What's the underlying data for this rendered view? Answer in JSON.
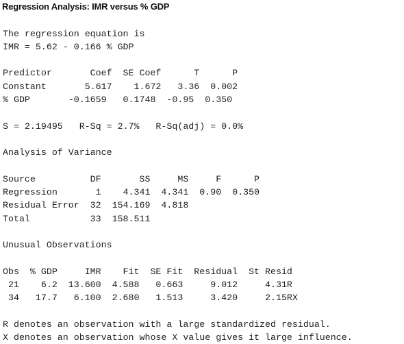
{
  "title": "Regression Analysis: IMR versus % GDP",
  "equation": {
    "intro": "The regression equation is",
    "formula": "IMR = 5.62 - 0.166 % GDP"
  },
  "coefficients": {
    "header": "Predictor       Coef  SE Coef      T      P",
    "rows": [
      "Constant       5.617    1.672   3.36  0.002",
      "% GDP       -0.1659   0.1748  -0.95  0.350"
    ],
    "data": [
      {
        "predictor": "Constant",
        "coef": "5.617",
        "se_coef": "1.672",
        "t": "3.36",
        "p": "0.002"
      },
      {
        "predictor": "% GDP",
        "coef": "-0.1659",
        "se_coef": "0.1748",
        "t": "-0.95",
        "p": "0.350"
      }
    ]
  },
  "fit_stats": {
    "line": "S = 2.19495   R-Sq = 2.7%   R-Sq(adj) = 0.0%",
    "s": "2.19495",
    "r_sq": "2.7%",
    "r_sq_adj": "0.0%"
  },
  "anova": {
    "heading": "Analysis of Variance",
    "header": "Source          DF       SS     MS     F      P",
    "rows": [
      "Regression       1    4.341  4.341  0.90  0.350",
      "Residual Error  32  154.169  4.818",
      "Total           33  158.511"
    ],
    "data": [
      {
        "source": "Regression",
        "df": "1",
        "ss": "4.341",
        "ms": "4.341",
        "f": "0.90",
        "p": "0.350"
      },
      {
        "source": "Residual Error",
        "df": "32",
        "ss": "154.169",
        "ms": "4.818"
      },
      {
        "source": "Total",
        "df": "33",
        "ss": "158.511"
      }
    ]
  },
  "unusual": {
    "heading": "Unusual Observations",
    "header": "Obs  % GDP     IMR    Fit  SE Fit  Residual  St Resid",
    "rows": [
      " 21    6.2  13.600  4.588   0.663     9.012     4.31R",
      " 34   17.7   6.100  2.680   1.513     3.420     2.15RX"
    ],
    "data": [
      {
        "obs": "21",
        "gdp": "6.2",
        "imr": "13.600",
        "fit": "4.588",
        "se_fit": "0.663",
        "residual": "9.012",
        "st_resid": "4.31R"
      },
      {
        "obs": "34",
        "gdp": "17.7",
        "imr": "6.100",
        "fit": "2.680",
        "se_fit": "1.513",
        "residual": "3.420",
        "st_resid": "2.15RX"
      }
    ]
  },
  "notes": [
    "R denotes an observation with a large standardized residual.",
    "X denotes an observation whose X value gives it large influence."
  ]
}
